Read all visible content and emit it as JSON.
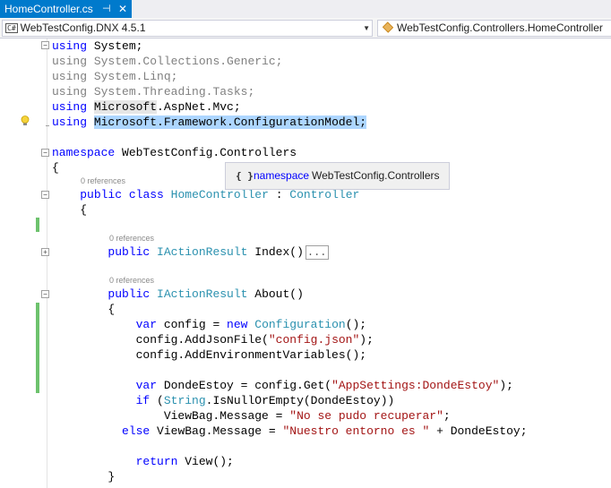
{
  "tab": {
    "title": "HomeController.cs",
    "pin": "⊣",
    "close": "✕"
  },
  "nav": {
    "project_badge": "C#",
    "project": "WebTestConfig.DNX 4.5.1",
    "project_arrow": "▼",
    "type_member": "WebTestConfig.Controllers.HomeController"
  },
  "code": {
    "using_kw": "using",
    "l1_ns": "System;",
    "l2_ns": "System.Collections.Generic;",
    "l3_ns": "System.Linq;",
    "l4_ns": "System.Threading.Tasks;",
    "l5_ns1": "Microsoft",
    "l5_ns2": ".AspNet.Mvc;",
    "l6_ns1": "Microsoft",
    "l6_ns2": ".Framework.ConfigurationModel;",
    "namespace_kw": "namespace",
    "namespace_name": " WebTestConfig.Controllers",
    "open_brace": "{",
    "close_brace": "}",
    "refs_class": "0 references",
    "public_kw": "public",
    "class_kw": "class",
    "class_name": "HomeController",
    "colon": " : ",
    "base_class": "Controller",
    "refs_index": "0 references",
    "iaction": "IActionResult",
    "index_sig": " Index()",
    "collapsed": "...",
    "refs_about": "0 references",
    "about_sig": " About()",
    "var_kw": "var",
    "config_assign": " config = ",
    "new_kw": "new",
    "configuration": "Configuration",
    "ctor_end": "();",
    "addjson_pre": "config.AddJsonFile(",
    "addjson_str": "\"config.json\"",
    "addjson_post": ");",
    "addenv": "config.AddEnvironmentVariables();",
    "donde_pre": " DondeEstoy = config.Get(",
    "donde_str": "\"AppSettings:DondeEstoy\"",
    "donde_post": ");",
    "if_kw": "if",
    "if_open": " (",
    "string_type": "String",
    "if_post": ".IsNullOrEmpty(DondeEstoy))",
    "viewbag_pre": "ViewBag.Message = ",
    "viewbag_str1": "\"No se pudo recuperar\"",
    "semicolon": ";",
    "else_kw": "else",
    "viewbag2_pre": " ViewBag.Message = ",
    "viewbag_str2": "\"Nuestro entorno es \"",
    "viewbag2_post": " + DondeEstoy;",
    "return_kw": "return",
    "return_post": " View();"
  },
  "tooltip": {
    "icon": "{ }",
    "keyword": "namespace",
    "name": "WebTestConfig.Controllers"
  },
  "colors": {
    "tab_accent": "#007acc",
    "keyword": "#0000ff",
    "type": "#2b91af",
    "string": "#a31515",
    "change_bar": "#6dc26d",
    "selection": "#add6ff"
  }
}
